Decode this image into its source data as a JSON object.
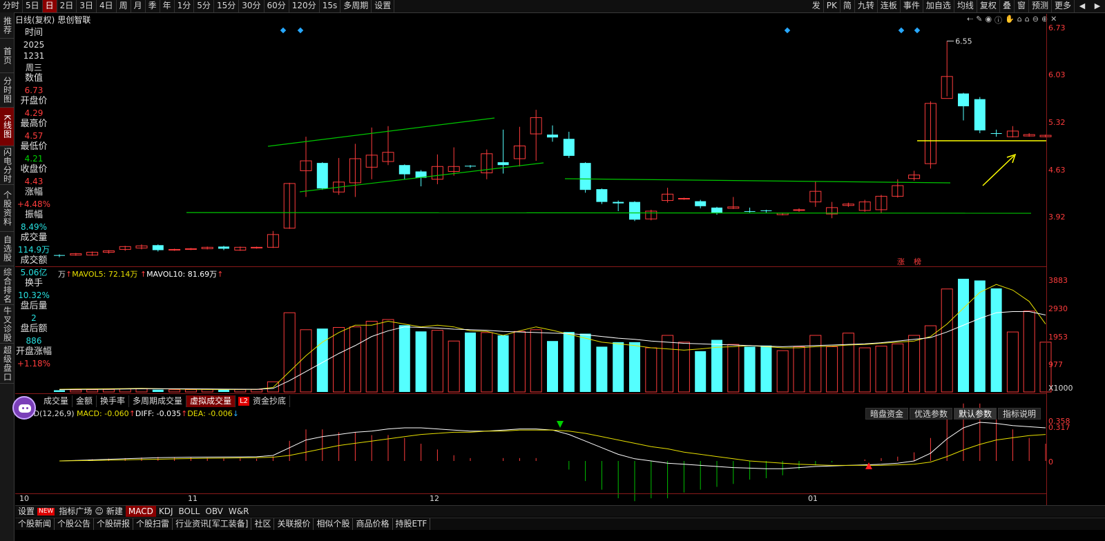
{
  "topbar": {
    "items": [
      "分时",
      "5日",
      "日",
      "2日",
      "3日",
      "4日",
      "周",
      "月",
      "季",
      "年",
      "1分",
      "5分",
      "15分",
      "30分",
      "60分",
      "120分",
      "15s",
      "多周期",
      "设置"
    ],
    "selected": "日",
    "right": [
      "发",
      "PK",
      "简",
      "九转",
      "连板",
      "事件",
      "加自选",
      "均线",
      "复权",
      "叠",
      "窗",
      "预测",
      "更多"
    ]
  },
  "leftnav": [
    "推荐",
    "首页",
    "分时图",
    "K线图",
    "闪电分时",
    "个股资料",
    "自选股",
    "综合排名",
    "牛叉诊股",
    "超级盘口"
  ],
  "leftnav_active": "K线图",
  "title": {
    "mode": "日线(复权)",
    "name": "思创智联"
  },
  "info": [
    {
      "label": "时间",
      "values": [
        "2025",
        "1231",
        "周三"
      ],
      "color": "w"
    },
    {
      "label": "数值",
      "values": [
        "6.73"
      ],
      "color": "r"
    },
    {
      "label": "开盘价",
      "values": [
        "4.29"
      ],
      "color": "r"
    },
    {
      "label": "最高价",
      "values": [
        "4.57"
      ],
      "color": "r"
    },
    {
      "label": "最低价",
      "values": [
        "4.21"
      ],
      "color": "g"
    },
    {
      "label": "收盘价",
      "values": [
        "4.43"
      ],
      "color": "r"
    },
    {
      "label": "涨幅",
      "values": [
        "+4.48%"
      ],
      "color": "r"
    },
    {
      "label": "振幅",
      "values": [
        "8.49%"
      ],
      "color": "c"
    },
    {
      "label": "成交量",
      "values": [
        "114.9万"
      ],
      "color": "c"
    },
    {
      "label": "成交额",
      "values": [
        "5.06亿"
      ],
      "color": "c"
    },
    {
      "label": "换手",
      "values": [
        "10.32%"
      ],
      "color": "c"
    },
    {
      "label": "盘后量",
      "values": [
        "2"
      ],
      "color": "c"
    },
    {
      "label": "盘后额",
      "values": [
        "886"
      ],
      "color": "c"
    },
    {
      "label": "开盘涨幅",
      "values": [
        "+1.18%"
      ],
      "color": "r"
    }
  ],
  "price_axis": [
    "6.73",
    "6.03",
    "5.32",
    "4.63",
    "3.92"
  ],
  "high_label": "6.55",
  "rank_labels": [
    "涨",
    "榜"
  ],
  "vol_legend": {
    "unit": "万",
    "mavol5_label": "MAVOL5: 72.14万",
    "mavol10_label": "MAVOL10: 81.69万"
  },
  "vol_axis": [
    "3883",
    "2930",
    "1953",
    "977",
    "X1000"
  ],
  "vol_tabs": [
    "成交量",
    "金额",
    "换手率",
    "多周期成交量",
    "虚拟成交量",
    "资金抄底"
  ],
  "vol_tab_selected": "虚拟成交量",
  "l2": "L2",
  "macd_legend": {
    "name": "MACD(12,26,9)",
    "macd": "MACD: -0.060",
    "diff": "DIFF: -0.035",
    "dea": "DEA: -0.006"
  },
  "macd_tabs": [
    "暗盘资金",
    "优选参数",
    "默认参数",
    "指标说明"
  ],
  "macd_tab_selected": "默认参数",
  "macd_axis": [
    "0.358",
    "0.317",
    "0"
  ],
  "x_axis": [
    "10",
    "11",
    "12",
    "01"
  ],
  "ind_tabs": [
    "设置",
    "指标广场",
    "新建",
    "MACD",
    "KDJ",
    "BOLL",
    "OBV",
    "W&R"
  ],
  "ind_new": "NEW",
  "ind_selected": "MACD",
  "bottom_tabs": [
    "个股新闻",
    "个股公告",
    "个股研报",
    "个股扫雷",
    "行业资讯[军工装备]",
    "社区",
    "关联报价",
    "相似个股",
    "商品价格",
    "持股ETF"
  ],
  "colors": {
    "up": "#ff3c3c",
    "down": "#54ffff",
    "ma5": "#e8e000",
    "ma10": "#ffffff",
    "trend": "#00c800",
    "support": "#ffff00"
  },
  "chart_data": {
    "type": "candlestick",
    "price_range": [
      3.4,
      6.73
    ],
    "candles": [
      [
        3.53,
        3.52,
        3.54,
        3.5
      ],
      [
        3.53,
        3.55,
        3.56,
        3.52
      ],
      [
        3.53,
        3.57,
        3.58,
        3.52
      ],
      [
        3.57,
        3.59,
        3.6,
        3.55
      ],
      [
        3.61,
        3.65,
        3.66,
        3.59
      ],
      [
        3.63,
        3.66,
        3.68,
        3.61
      ],
      [
        3.67,
        3.6,
        3.68,
        3.58
      ],
      [
        3.6,
        3.61,
        3.62,
        3.59
      ],
      [
        3.61,
        3.62,
        3.63,
        3.6
      ],
      [
        3.62,
        3.64,
        3.65,
        3.61
      ],
      [
        3.65,
        3.62,
        3.66,
        3.6
      ],
      [
        3.6,
        3.64,
        3.65,
        3.59
      ],
      [
        3.63,
        3.64,
        3.65,
        3.62
      ],
      [
        3.64,
        3.82,
        3.87,
        3.63
      ],
      [
        3.91,
        4.54,
        4.55,
        3.9
      ],
      [
        4.72,
        4.86,
        5.2,
        4.35
      ],
      [
        4.83,
        4.47,
        4.84,
        4.45
      ],
      [
        4.42,
        4.56,
        4.9,
        4.38
      ],
      [
        4.55,
        4.89,
        5.1,
        4.35
      ],
      [
        4.77,
        4.94,
        5.33,
        4.6
      ],
      [
        4.85,
        4.98,
        5.35,
        4.8
      ],
      [
        4.8,
        4.67,
        4.81,
        4.6
      ],
      [
        4.71,
        4.62,
        4.73,
        4.5
      ],
      [
        4.6,
        4.78,
        4.95,
        4.53
      ],
      [
        4.71,
        4.78,
        5.05,
        4.65
      ],
      [
        4.79,
        4.78,
        4.8,
        4.76
      ],
      [
        4.69,
        4.96,
        5.02,
        4.6
      ],
      [
        4.84,
        4.8,
        5.3,
        4.68
      ],
      [
        4.89,
        5.07,
        5.34,
        4.78
      ],
      [
        5.24,
        5.47,
        5.58,
        4.86
      ],
      [
        5.23,
        5.19,
        5.36,
        5.13
      ],
      [
        5.17,
        4.93,
        5.27,
        4.9
      ],
      [
        4.83,
        4.45,
        4.84,
        4.41
      ],
      [
        4.46,
        4.28,
        4.47,
        4.25
      ],
      [
        4.28,
        4.26,
        4.3,
        4.15
      ],
      [
        4.28,
        4.03,
        4.29,
        4.01
      ],
      [
        4.04,
        4.15,
        4.17,
        4.02
      ],
      [
        4.3,
        4.39,
        4.48,
        4.27
      ],
      [
        4.32,
        4.33,
        4.34,
        4.31
      ],
      [
        4.29,
        4.22,
        4.31,
        4.19
      ],
      [
        4.2,
        4.12,
        4.21,
        4.1
      ],
      [
        4.19,
        4.21,
        4.35,
        4.18
      ],
      [
        4.15,
        4.14,
        4.2,
        4.12
      ],
      [
        4.16,
        4.15,
        4.17,
        4.12
      ],
      [
        4.1,
        4.12,
        4.13,
        4.09
      ],
      [
        4.16,
        4.17,
        4.19,
        4.14
      ],
      [
        4.28,
        4.43,
        4.57,
        4.21
      ],
      [
        4.11,
        4.2,
        4.28,
        4.05
      ],
      [
        4.23,
        4.25,
        4.27,
        4.21
      ],
      [
        4.16,
        4.28,
        4.31,
        4.14
      ],
      [
        4.17,
        4.36,
        4.38,
        4.12
      ],
      [
        4.36,
        4.51,
        4.6,
        4.34
      ],
      [
        4.61,
        4.66,
        4.72,
        4.58
      ],
      [
        4.82,
        5.67,
        5.7,
        4.75
      ],
      [
        5.74,
        6.05,
        6.55,
        5.77
      ],
      [
        5.81,
        5.63,
        5.82,
        5.43
      ],
      [
        5.73,
        5.29,
        5.76,
        5.25
      ],
      [
        5.25,
        5.24,
        5.3,
        5.2
      ],
      [
        5.2,
        5.28,
        5.35,
        5.19
      ],
      [
        5.21,
        5.23,
        5.25,
        5.2
      ],
      [
        5.2,
        5.22,
        5.23,
        5.19
      ]
    ],
    "volume": [
      30,
      35,
      40,
      45,
      55,
      58,
      40,
      40,
      42,
      45,
      40,
      42,
      44,
      180,
      1400,
      1100,
      1120,
      1140,
      1150,
      1250,
      1280,
      1180,
      1070,
      1090,
      900,
      1050,
      1050,
      1000,
      1070,
      1100,
      900,
      1060,
      1030,
      800,
      880,
      880,
      780,
      1000,
      880,
      720,
      920,
      840,
      800,
      820,
      730,
      800,
      1000,
      800,
      1040,
      780,
      810,
      850,
      1000,
      1170,
      1820,
      2280,
      1970,
      1830,
      1060,
      1430,
      880
    ],
    "ma5": [
      48,
      52,
      54,
      56,
      60,
      64,
      58,
      52,
      48,
      44,
      42,
      44,
      45,
      80,
      360,
      640,
      880,
      1050,
      1180,
      1180,
      1250,
      1200,
      1150,
      1180,
      1150,
      1080,
      1070,
      1000,
      1080,
      1150,
      1090,
      1020,
      950,
      880,
      850,
      820,
      780,
      760,
      740,
      760,
      790,
      800,
      820,
      800,
      780,
      780,
      800,
      810,
      830,
      840,
      860,
      880,
      900,
      980,
      1200,
      1480,
      1760,
      1900,
      1800,
      1600,
      1200
    ],
    "ma10": [
      40,
      44,
      46,
      48,
      52,
      56,
      56,
      56,
      55,
      54,
      50,
      49,
      48,
      62,
      200,
      360,
      520,
      680,
      820,
      980,
      1080,
      1150,
      1140,
      1130,
      1110,
      1100,
      1090,
      1070,
      1060,
      1050,
      1040,
      1030,
      1010,
      980,
      950,
      930,
      900,
      880,
      860,
      850,
      840,
      830,
      820,
      810,
      800,
      810,
      820,
      830,
      840,
      850,
      870,
      900,
      930,
      960,
      1060,
      1180,
      1300,
      1400,
      1420,
      1420,
      1360
    ],
    "macd_diff": [
      0,
      0.005,
      0.01,
      0.015,
      0.02,
      0.025,
      0.03,
      0.032,
      0.034,
      0.035,
      0.036,
      0.037,
      0.038,
      0.05,
      0.12,
      0.19,
      0.22,
      0.24,
      0.26,
      0.27,
      0.29,
      0.3,
      0.3,
      0.29,
      0.28,
      0.27,
      0.27,
      0.28,
      0.29,
      0.29,
      0.28,
      0.24,
      0.18,
      0.12,
      0.06,
      0.02,
      0.0,
      -0.02,
      -0.03,
      -0.04,
      -0.05,
      -0.06,
      -0.065,
      -0.07,
      -0.07,
      -0.06,
      -0.05,
      -0.045,
      -0.04,
      -0.035,
      -0.03,
      -0.02,
      0.0,
      0.07,
      0.2,
      0.3,
      0.35,
      0.34,
      0.32,
      0.31,
      0.3
    ],
    "macd_dea": [
      0,
      0.002,
      0.004,
      0.007,
      0.01,
      0.013,
      0.016,
      0.019,
      0.022,
      0.024,
      0.026,
      0.028,
      0.03,
      0.034,
      0.05,
      0.08,
      0.11,
      0.14,
      0.16,
      0.18,
      0.2,
      0.22,
      0.24,
      0.25,
      0.26,
      0.26,
      0.27,
      0.27,
      0.28,
      0.28,
      0.28,
      0.27,
      0.25,
      0.22,
      0.19,
      0.16,
      0.13,
      0.11,
      0.08,
      0.06,
      0.04,
      0.02,
      0.0,
      -0.01,
      -0.02,
      -0.03,
      -0.035,
      -0.04,
      -0.04,
      -0.04,
      -0.04,
      -0.035,
      -0.03,
      -0.01,
      0.04,
      0.1,
      0.15,
      0.19,
      0.21,
      0.23,
      0.24
    ]
  }
}
